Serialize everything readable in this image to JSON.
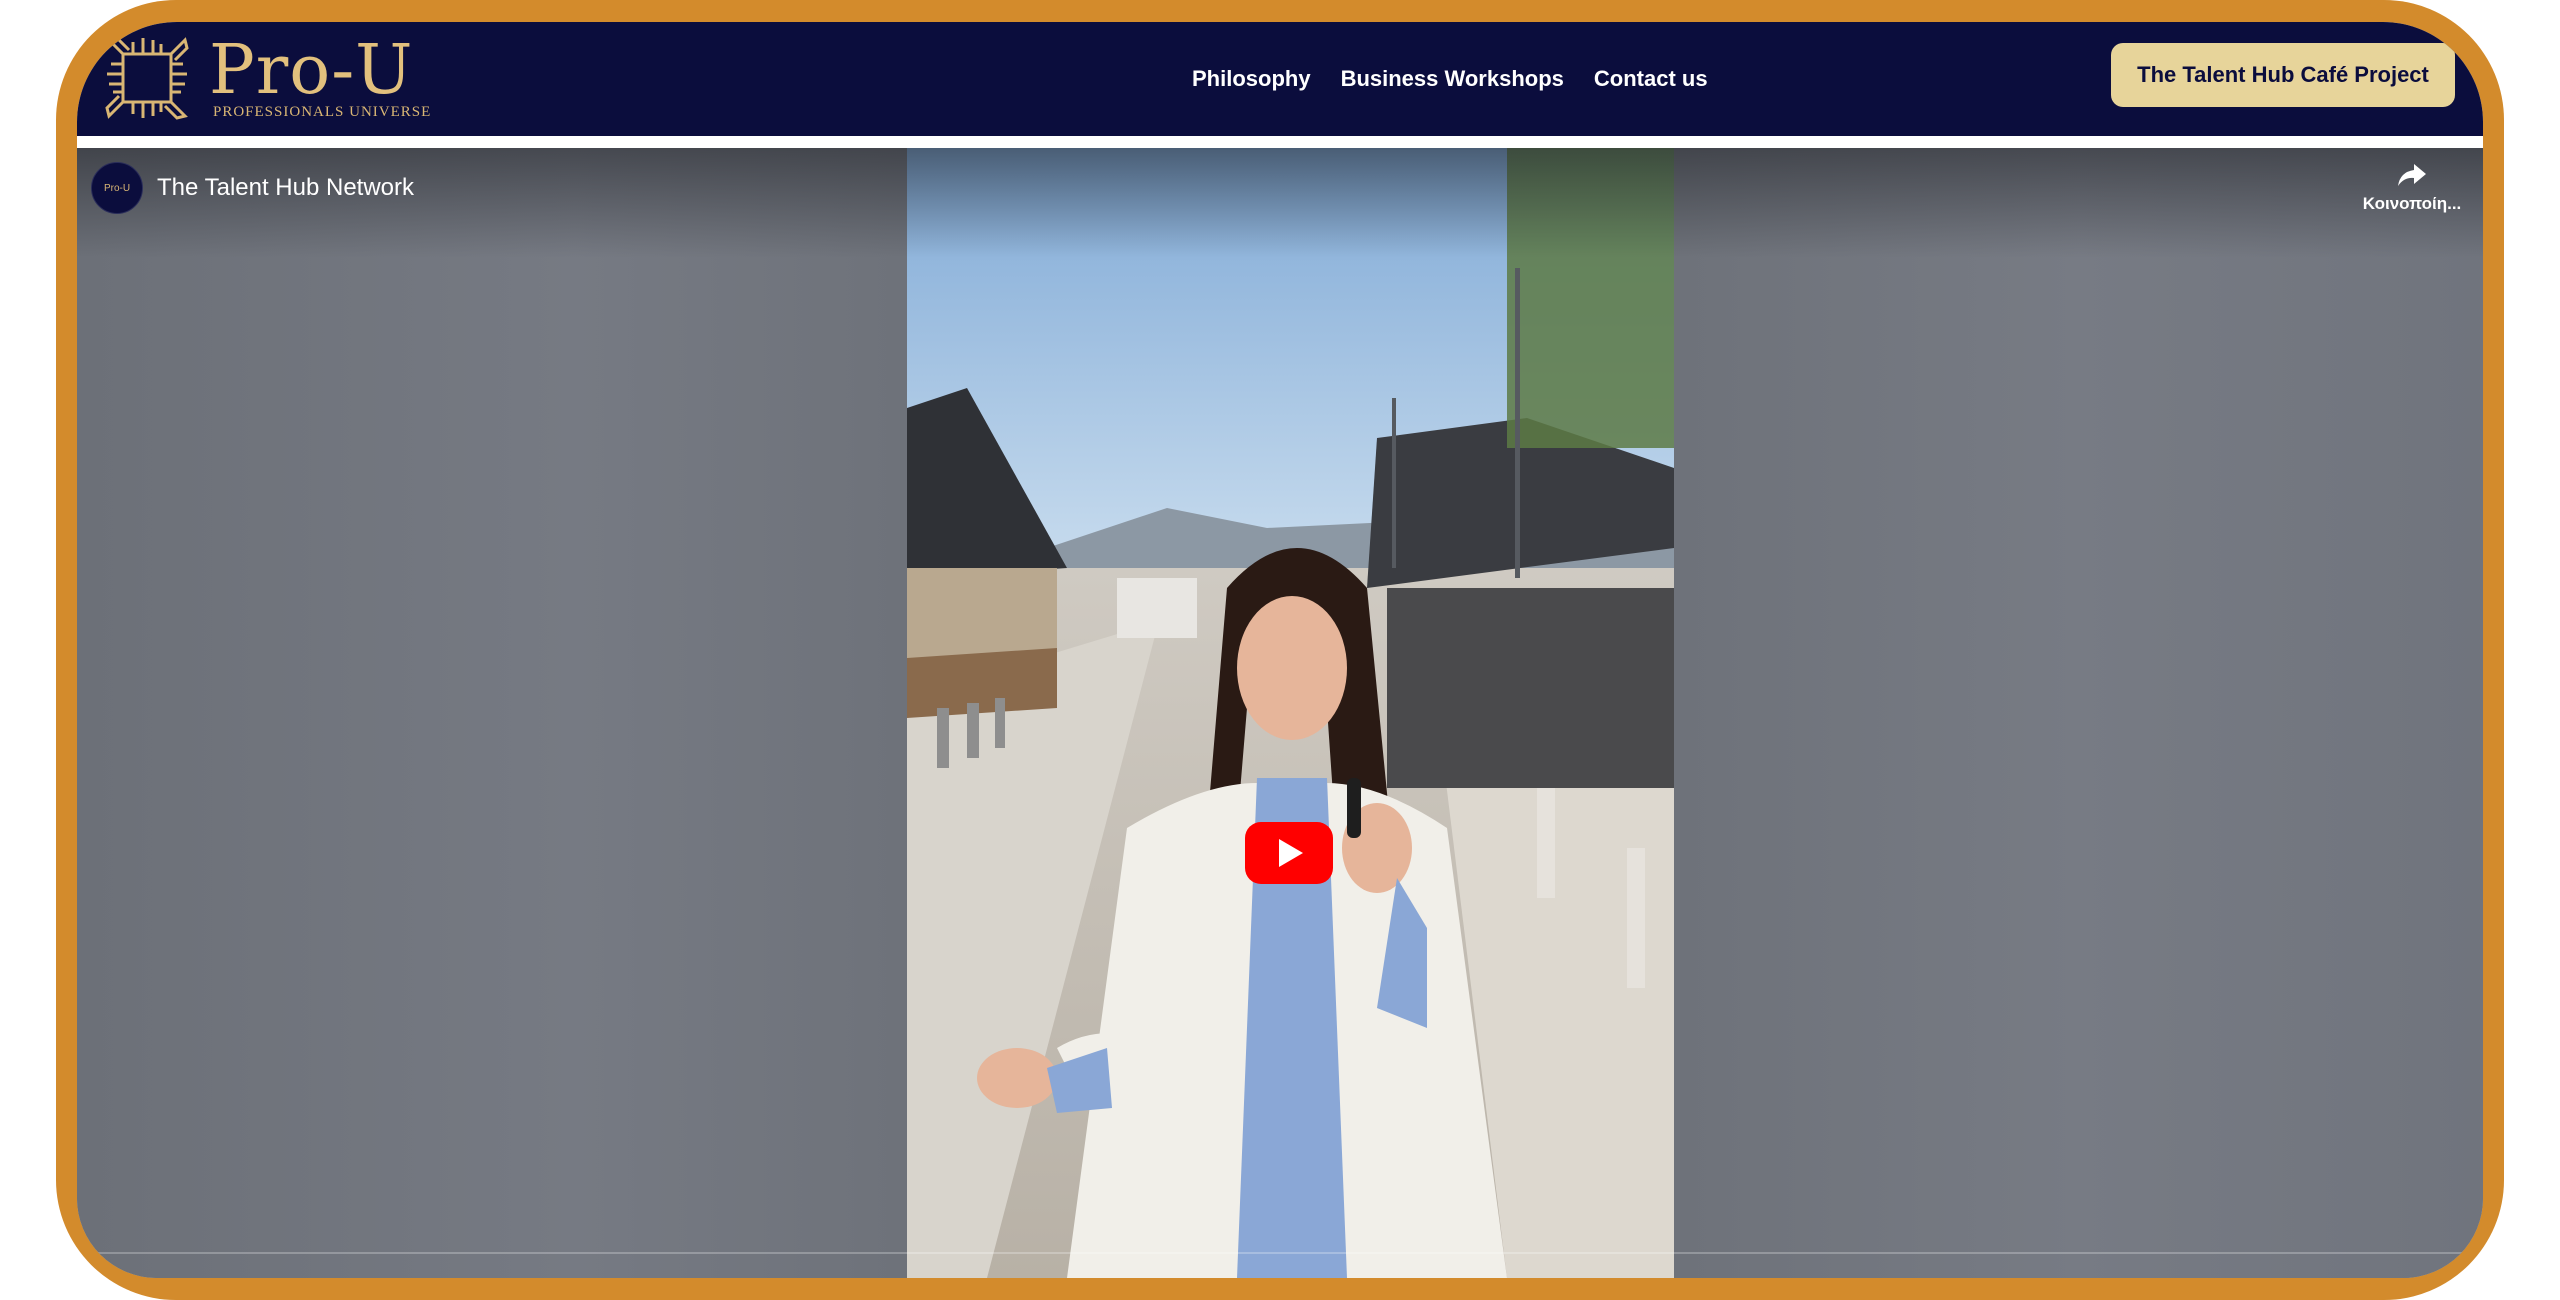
{
  "navbar": {
    "logo": {
      "title": "Pro-U",
      "subtitle": "PROFESSIONALS UNIVERSE",
      "icon": "four-hands-square-logo-icon"
    },
    "links": [
      {
        "label": "Philosophy"
      },
      {
        "label": "Business Workshops"
      },
      {
        "label": "Contact us"
      }
    ],
    "cta_label": "The Talent Hub Café Project"
  },
  "video": {
    "channel_name": "The Talent Hub Network",
    "channel_avatar_text": "Pro-U",
    "share_label": "Κοινοποίη...",
    "play_icon": "youtube-play-icon",
    "share_icon": "share-arrow-icon"
  },
  "colors": {
    "frame": "#d38b2c",
    "navbar": "#0b0d3d",
    "cta": "#e7d49a",
    "logo_gold": "#e2c07d",
    "play_red": "#ff0000"
  }
}
